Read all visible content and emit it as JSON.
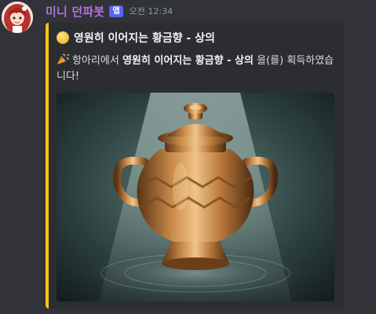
{
  "message": {
    "username": "미니 던파봇",
    "badge": "앱",
    "timestamp": "오전 12:34",
    "avatar_icon": "anime-girl-avatar"
  },
  "embed": {
    "accent_color": "#f5c518",
    "title_icon": "yellow-circle-icon",
    "title": "영원히 이어지는 황금향 - 상의",
    "description_icon": "party-popper-icon",
    "description_prefix": "항아리에서",
    "description_item": "영원히 이어지는 황금향 - 상의",
    "description_suffix": "을(를) 획득하였습니다!",
    "image_subject": "golden-urn"
  }
}
